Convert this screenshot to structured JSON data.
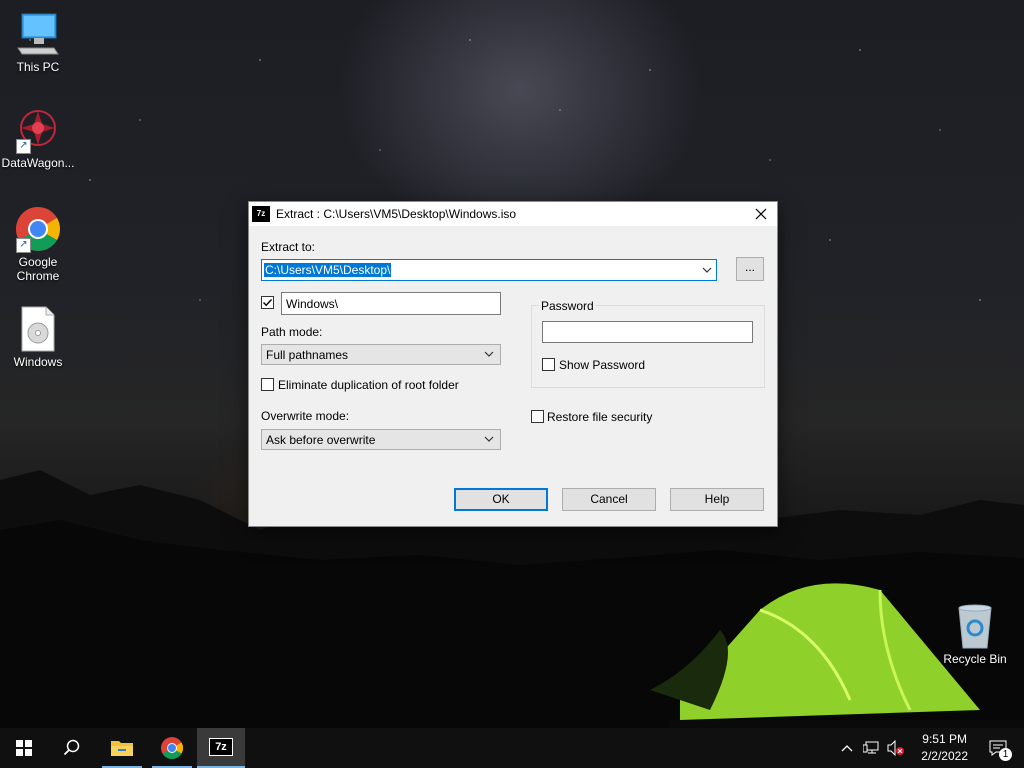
{
  "desktop": {
    "icons": [
      {
        "name": "this-pc",
        "label": "This PC"
      },
      {
        "name": "datawagon",
        "label": "DataWagon..."
      },
      {
        "name": "google-chrome",
        "label": "Google Chrome"
      },
      {
        "name": "windows-iso",
        "label": "Windows"
      },
      {
        "name": "recycle-bin",
        "label": "Recycle Bin"
      }
    ]
  },
  "dialog": {
    "title": "Extract : C:\\Users\\VM5\\Desktop\\Windows.iso",
    "app_icon": "7z",
    "extract_to_label": "Extract to:",
    "extract_to_value": "C:\\Users\\VM5\\Desktop\\",
    "browse_label": "...",
    "subfolder_checked": true,
    "subfolder_value": "Windows\\",
    "path_mode_label": "Path mode:",
    "path_mode_value": "Full pathnames",
    "eliminate_dup_label": "Eliminate duplication of root folder",
    "eliminate_dup_checked": false,
    "overwrite_mode_label": "Overwrite mode:",
    "overwrite_mode_value": "Ask before overwrite",
    "password_group_label": "Password",
    "password_value": "",
    "show_password_label": "Show Password",
    "show_password_checked": false,
    "restore_security_label": "Restore file security",
    "restore_security_checked": false,
    "ok_label": "OK",
    "cancel_label": "Cancel",
    "help_label": "Help"
  },
  "taskbar": {
    "items": [
      "start-icon",
      "search-icon",
      "file-explorer-icon",
      "chrome-icon",
      "7zip-icon"
    ],
    "active": "7zip-icon",
    "time": "9:51 PM",
    "date": "2/2/2022",
    "notification_count": "1"
  },
  "colors": {
    "accent": "#0078d7",
    "selection": "#0078d7",
    "tent_green": "#9fe02a"
  }
}
